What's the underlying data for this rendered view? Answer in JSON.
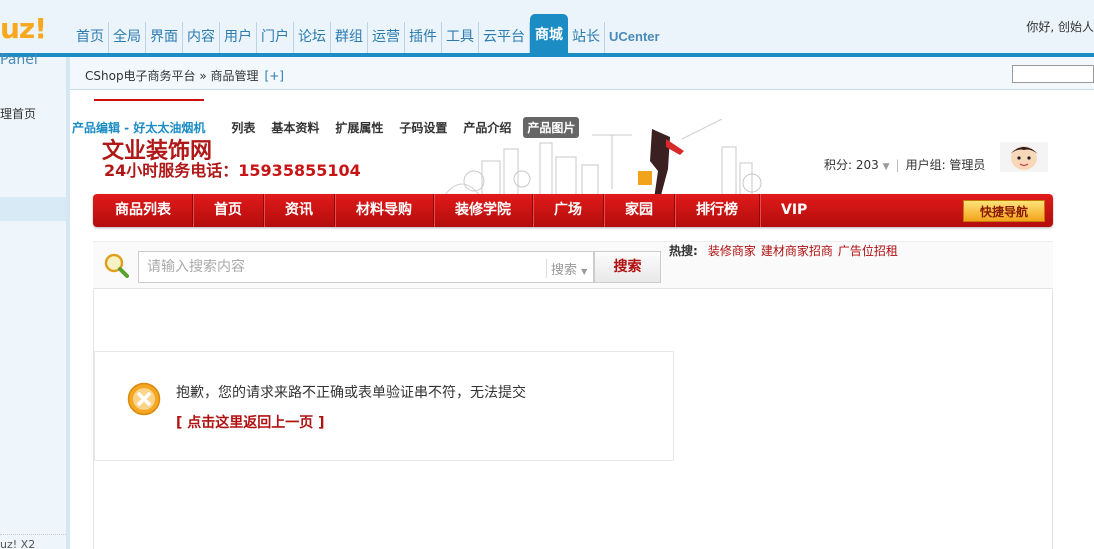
{
  "logo": {
    "main": "uz!",
    "sub": "Panel"
  },
  "topnav": {
    "items": [
      "首页",
      "全局",
      "界面",
      "内容",
      "用户",
      "门户",
      "论坛",
      "群组",
      "运营",
      "插件",
      "工具",
      "云平台",
      "商城",
      "站长",
      "UCenter"
    ],
    "active": "商城",
    "greeting": "你好, 创始人"
  },
  "sidebar": {
    "home": "理首页",
    "footer": "uz! X2"
  },
  "breadcrumb": {
    "text": "CShop电子商务平台 » 商品管理",
    "add": "[+]"
  },
  "subtabs": {
    "title": "产品编辑 - 好太太油烟机",
    "tabs": [
      "列表",
      "基本资料",
      "扩展属性",
      "子码设置",
      "产品介绍",
      "产品图片"
    ],
    "active": "产品图片"
  },
  "banner": {
    "title": "文业装饰网",
    "phone_prefix": "24小时服务电话：",
    "phone": "15935855104",
    "score": "积分: 203",
    "usergroup": "用户组: 管理员"
  },
  "menu": {
    "items": [
      "商品列表",
      "首页",
      "资讯",
      "材料导购",
      "装修学院",
      "广场",
      "家园",
      "排行榜",
      "VIP"
    ],
    "quicknav": "快捷导航"
  },
  "search": {
    "placeholder": "请输入搜索内容",
    "select": "搜索",
    "button": "搜索",
    "hot_label": "热搜:",
    "hot_links": [
      "装修商家",
      "建材商家招商",
      "广告位招租"
    ]
  },
  "message": {
    "text": "抱歉，您的请求来路不正确或表单验证串不符，无法提交",
    "back": "[ 点击这里返回上一页 ]"
  },
  "colors": {
    "admin_blue": "#1c8cc4",
    "site_red": "#c81414",
    "logo_orange": "#f8a81c"
  }
}
